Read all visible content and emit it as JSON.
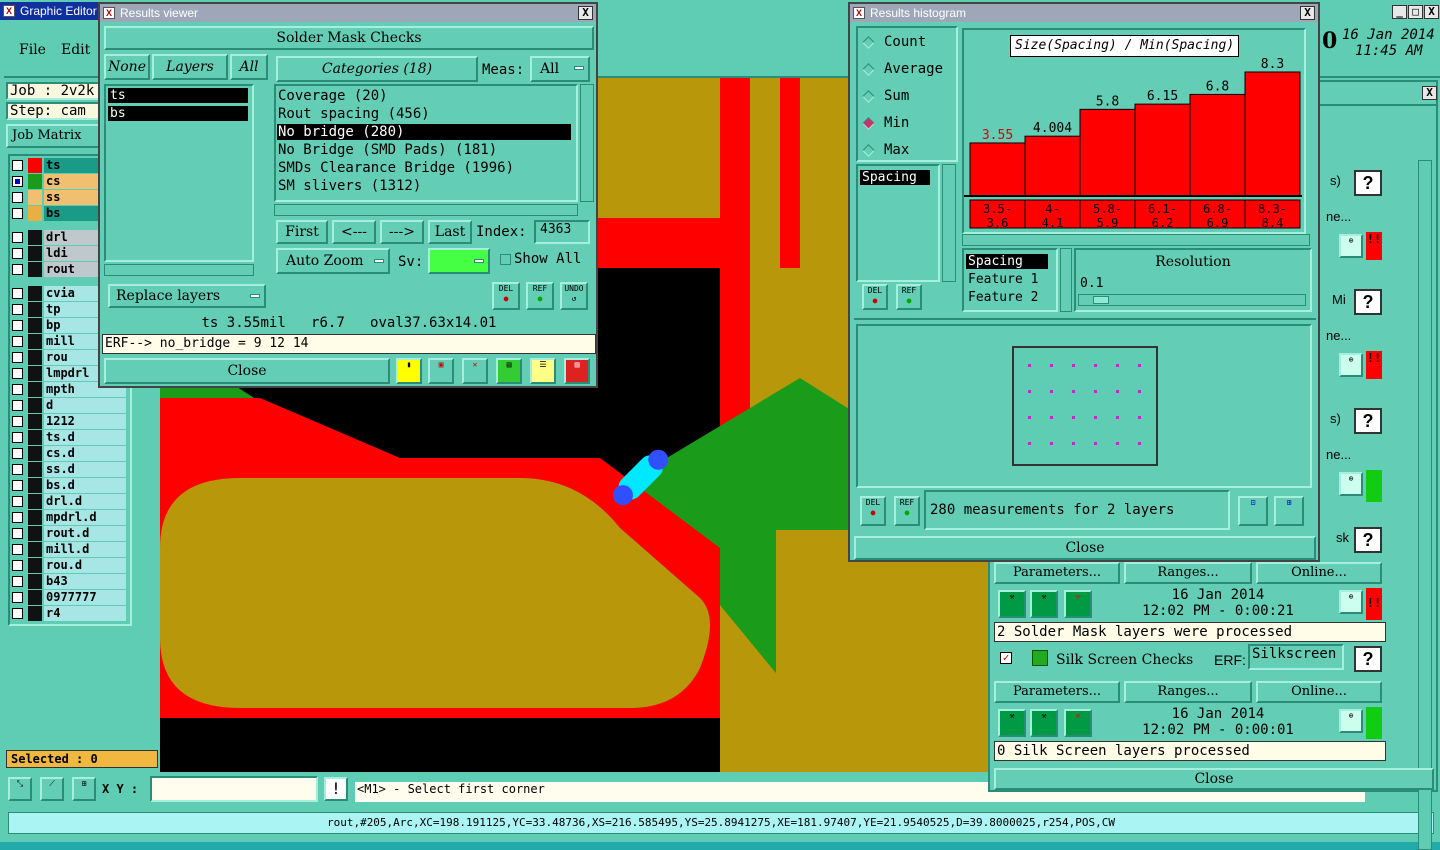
{
  "graphic_editor": {
    "title": "Graphic Editor",
    "menu": [
      "File",
      "Edit"
    ],
    "job_label": "Job : 2v2k",
    "step_label": "Step: cam",
    "job_matrix_button": "Job Matrix",
    "date": "16 Jan 2014",
    "time": "11:45 AM",
    "date_prefix": "0",
    "layers": [
      {
        "name": "ts",
        "color": "#ff0000"
      },
      {
        "name": "cs",
        "color": "#1a9b1a"
      },
      {
        "name": "ss",
        "color": "#f0c070"
      },
      {
        "name": "bs",
        "color": "#e8b040"
      },
      {
        "name": "drl",
        "color": ""
      },
      {
        "name": "ldi",
        "color": ""
      },
      {
        "name": "rout",
        "color": ""
      },
      {
        "name": "cvia",
        "color": ""
      },
      {
        "name": "tp",
        "color": ""
      },
      {
        "name": "bp",
        "color": ""
      },
      {
        "name": "mill",
        "color": ""
      },
      {
        "name": "rou",
        "color": ""
      },
      {
        "name": "lmpdrl",
        "color": ""
      },
      {
        "name": "mpth",
        "color": ""
      },
      {
        "name": "d",
        "color": ""
      },
      {
        "name": "1212",
        "color": ""
      },
      {
        "name": "ts.d",
        "color": ""
      },
      {
        "name": "cs.d",
        "color": ""
      },
      {
        "name": "ss.d",
        "color": ""
      },
      {
        "name": "bs.d",
        "color": ""
      },
      {
        "name": "drl.d",
        "color": ""
      },
      {
        "name": "mpdrl.d",
        "color": ""
      },
      {
        "name": "rout.d",
        "color": ""
      },
      {
        "name": "mill.d",
        "color": ""
      },
      {
        "name": "rou.d",
        "color": ""
      },
      {
        "name": "b43",
        "color": ""
      },
      {
        "name": "0977777",
        "color": ""
      },
      {
        "name": "r4",
        "color": ""
      }
    ],
    "selected_label": "Selected : 0",
    "xy_label": "X Y :",
    "xy_value": "",
    "prompt": "<M1> - Select first corner",
    "status_line": "rout,#205,Arc,XC=198.191125,YC=33.48736,XS=216.585495,YS=25.8941275,XE=181.97407,YE=21.9540525,D=39.8000025,r254,POS,CW"
  },
  "results_viewer": {
    "title": "Results viewer",
    "header": "Solder Mask Checks",
    "none_tab": "None",
    "layers_tab": "Layers",
    "all_tab": "All",
    "categories_tab": "Categories (18)",
    "meas_label": "Meas:",
    "meas_value": "All",
    "layer_list": [
      "ts",
      "bs"
    ],
    "categories": [
      "Coverage (20)",
      "Rout spacing (456)",
      "No bridge (280)",
      "No Bridge (SMD Pads) (181)",
      "SMDs Clearance Bridge (1996)",
      "SM slivers (1312)"
    ],
    "selected_category": 2,
    "first": "First",
    "prev": "<---",
    "next": "--->",
    "last": "Last",
    "index_label": "Index:",
    "index_value": "4363",
    "auto_zoom": "Auto Zoom",
    "sv_label": "Sv:",
    "show_all": "Show All",
    "replace_layers": "Replace layers",
    "del": "DEL",
    "ref": "REF",
    "undo": "UNDO",
    "info": "ts 3.55mil   r6.7   oval37.63x14.01",
    "erf": "ERF--> no_bridge = 9 12 14",
    "close": "Close"
  },
  "histogram": {
    "title": "Results histogram",
    "radios": [
      "Count",
      "Average",
      "Sum",
      "Min",
      "Max"
    ],
    "selected_radio": 3,
    "chart_title": "Size(Spacing) / Min(Spacing)",
    "list_item": "Spacing",
    "del": "DEL",
    "ref": "REF",
    "fields": [
      "Spacing",
      "Feature 1",
      "Feature 2"
    ],
    "resolution_label": "Resolution",
    "resolution_value": "0.1",
    "summary": "280 measurements for 2 layers",
    "close": "Close"
  },
  "chart_data": {
    "type": "bar",
    "title": "Size(Spacing) / Min(Spacing)",
    "categories": [
      "3.5-3.6",
      "4-4.1",
      "5.8-5.9",
      "6.1-6.2",
      "6.8-6.9",
      "8.3-8.4"
    ],
    "values": [
      3.55,
      4.004,
      5.8,
      6.15,
      6.8,
      8.3
    ],
    "value_labels": [
      "3.55",
      "4.004",
      "5.8",
      "6.15",
      "6.8",
      "8.3"
    ],
    "bar_color": "#ff0000",
    "highlight_label_color": "#e00000"
  },
  "checklist": {
    "close_icon": "X",
    "partial_labels": [
      "s)",
      "ne...",
      "Mi",
      "ne...",
      "s)",
      "ne...",
      "sk"
    ],
    "parameters": "Parameters...",
    "ranges": "Ranges...",
    "online": "Online...",
    "run1_date": "16 Jan 2014",
    "run1_time": "12:02 PM - 0:00:21",
    "run1_msg": "2 Solder Mask layers were processed",
    "silk_title": "Silk Screen Checks",
    "erf_label": "ERF:",
    "erf_value": "Silkscreen",
    "run2_date": "16 Jan 2014",
    "run2_time": "12:02 PM - 0:00:01",
    "run2_msg": "0 Silk Screen layers processed",
    "close": "Close",
    "help": "?"
  }
}
